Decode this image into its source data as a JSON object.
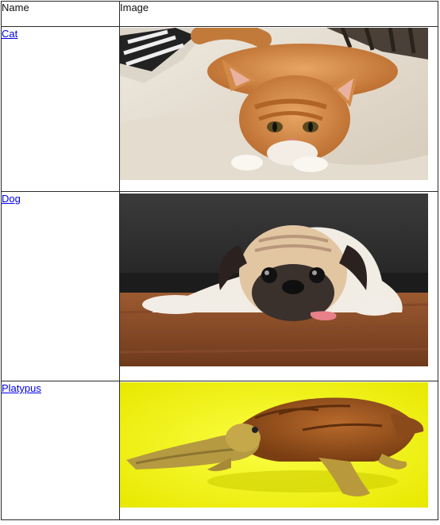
{
  "table": {
    "headers": {
      "name": "Name",
      "image": "Image"
    },
    "rows": [
      {
        "name": "Cat",
        "image_icon": "cat-photo"
      },
      {
        "name": "Dog",
        "image_icon": "pug-photo"
      },
      {
        "name": "Platypus",
        "image_icon": "platypus-photo"
      }
    ]
  }
}
